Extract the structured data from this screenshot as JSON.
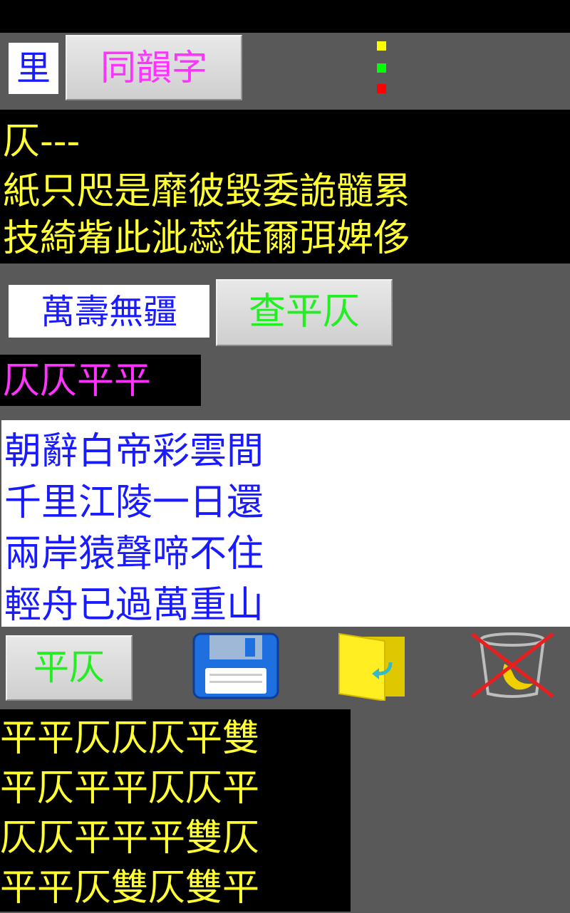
{
  "header": {
    "char_input_value": "里",
    "rhyme_button_label": "同韻字",
    "indicator_colors": [
      "#ffff00",
      "#00ff00",
      "#ff0000"
    ]
  },
  "rhyme_panel": {
    "lines": [
      "仄---",
      "紙只咫是靡彼毀委詭髓累",
      "技綺觜此泚蕊徙爾弭婢侈"
    ]
  },
  "tone_check": {
    "phrase_input_value": "萬壽無疆",
    "check_button_label": "查平仄",
    "result_parts": [
      {
        "text": "仄仄",
        "color": "#ff33ff"
      },
      {
        "text": "平平",
        "color": "#ff33ff"
      }
    ]
  },
  "poem": {
    "lines": [
      "朝辭白帝彩雲間",
      "千里江陵一日還",
      "兩岸猿聲啼不住",
      "輕舟已過萬重山"
    ]
  },
  "toolbar": {
    "pingze_button_label": "平仄",
    "icons": [
      "save-icon",
      "open-file-icon",
      "clear-icon"
    ]
  },
  "pattern_panel": {
    "lines": [
      "平平仄仄仄平雙",
      "平仄平平仄仄平",
      "仄仄平平平雙仄",
      "平平仄雙仄雙平"
    ]
  },
  "colors": {
    "background": "#595959",
    "text_yellow": "#ffff33",
    "text_blue": "#1a1aff",
    "text_green": "#22ee22",
    "text_magenta": "#ff33ff"
  }
}
